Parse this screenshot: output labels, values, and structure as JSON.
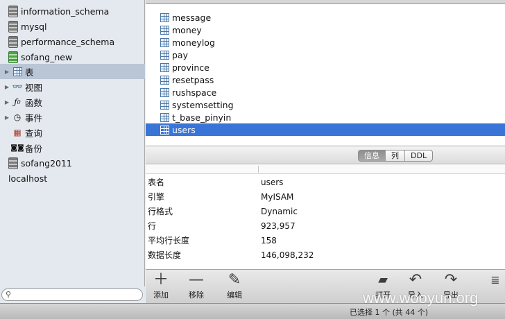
{
  "sidebar": {
    "items": [
      {
        "label": "information_schema",
        "icon": "database-icon"
      },
      {
        "label": "mysql",
        "icon": "database-icon"
      },
      {
        "label": "performance_schema",
        "icon": "database-icon"
      },
      {
        "label": "sofang_new",
        "icon": "database-icon-open"
      },
      {
        "label": "表",
        "icon": "table-icon"
      },
      {
        "label": "视图",
        "icon": "view-icon"
      },
      {
        "label": "函数",
        "icon": "function-icon"
      },
      {
        "label": "事件",
        "icon": "clock-icon"
      },
      {
        "label": "查询",
        "icon": "query-icon"
      },
      {
        "label": "备份",
        "icon": "backup-icon"
      },
      {
        "label": "sofang2011",
        "icon": "database-icon"
      },
      {
        "label": "localhost",
        "icon": "server-icon"
      }
    ],
    "search_placeholder": ""
  },
  "table_list": {
    "items": [
      "message",
      "money",
      "moneylog",
      "pay",
      "province",
      "resetpass",
      "rushspace",
      "systemsetting",
      "t_base_pinyin",
      "users"
    ],
    "selected": "users"
  },
  "tabs": [
    "信息",
    "列",
    "DDL"
  ],
  "active_tab": "信息",
  "info": {
    "rows": [
      {
        "key": "表名",
        "value": "users"
      },
      {
        "key": "引擎",
        "value": "MyISAM"
      },
      {
        "key": "行格式",
        "value": "Dynamic"
      },
      {
        "key": "行",
        "value": "923,957"
      },
      {
        "key": "平均行长度",
        "value": "158"
      },
      {
        "key": "数据长度",
        "value": "146,098,232"
      }
    ]
  },
  "toolbar": {
    "add": "添加",
    "remove": "移除",
    "edit": "编辑",
    "open": "打开",
    "import": "导入",
    "export": "导出"
  },
  "status": {
    "text": "已选择 1 个 (共 44 个)",
    "watermark": "www.wooyun.org"
  },
  "colors": {
    "selection_blue": "#3875d7",
    "sidebar_bg": "#e4e9ef",
    "sidebar_selected": "#bac6d6"
  }
}
